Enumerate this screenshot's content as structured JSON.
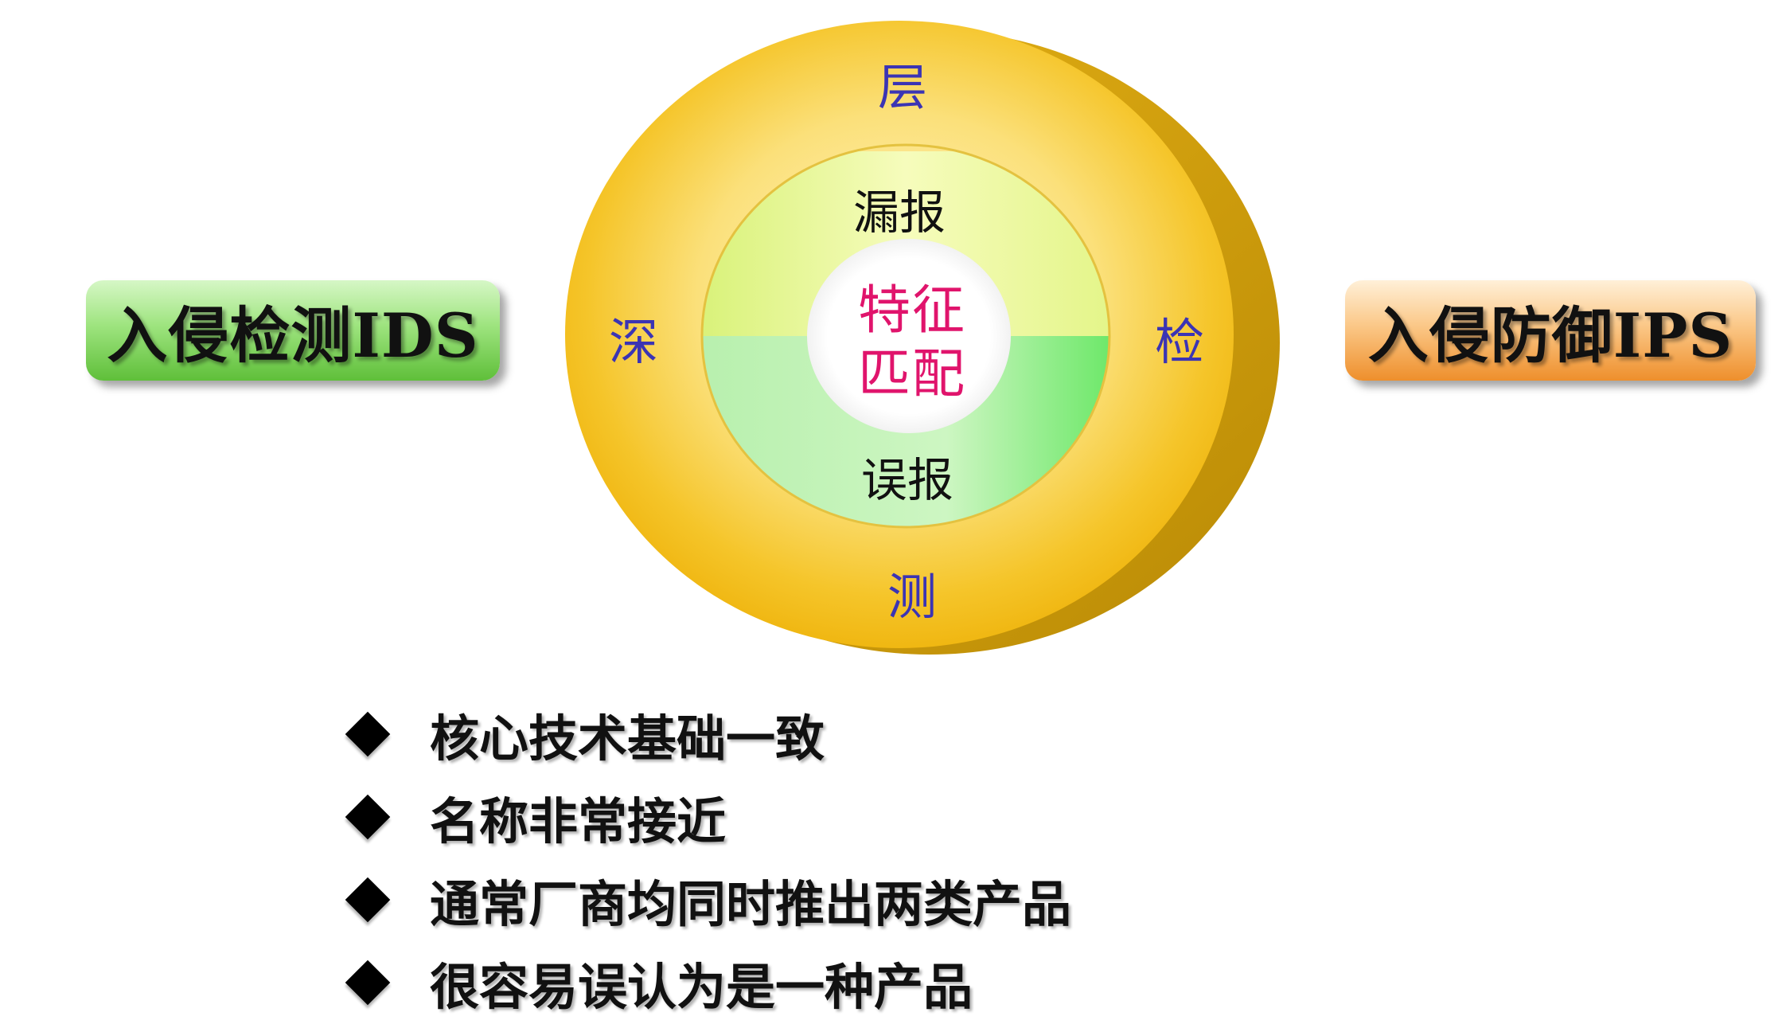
{
  "left_label": "入侵检测IDS",
  "right_label": "入侵防御IPS",
  "ring": {
    "outer_chars": {
      "top": "层",
      "left": "深",
      "right": "检",
      "bottom": "测"
    },
    "inner_top": "漏报",
    "inner_bottom": "误报",
    "center_line1": "特征",
    "center_line2": "匹配"
  },
  "bullets": [
    "核心技术基础一致",
    "名称非常接近",
    "通常厂商均同时推出两类产品",
    "很容易误认为是一种产品"
  ],
  "colors": {
    "outer_ring": "#f7c325",
    "outer_ring_shadow": "#d9a60e",
    "inner_top": "#eaf98a",
    "inner_bottom": "#8fe88a",
    "center_text": "#e0146c",
    "ring_text": "#3b34b4",
    "ids_box": "#7ed35a",
    "ips_box": "#f4a550"
  }
}
